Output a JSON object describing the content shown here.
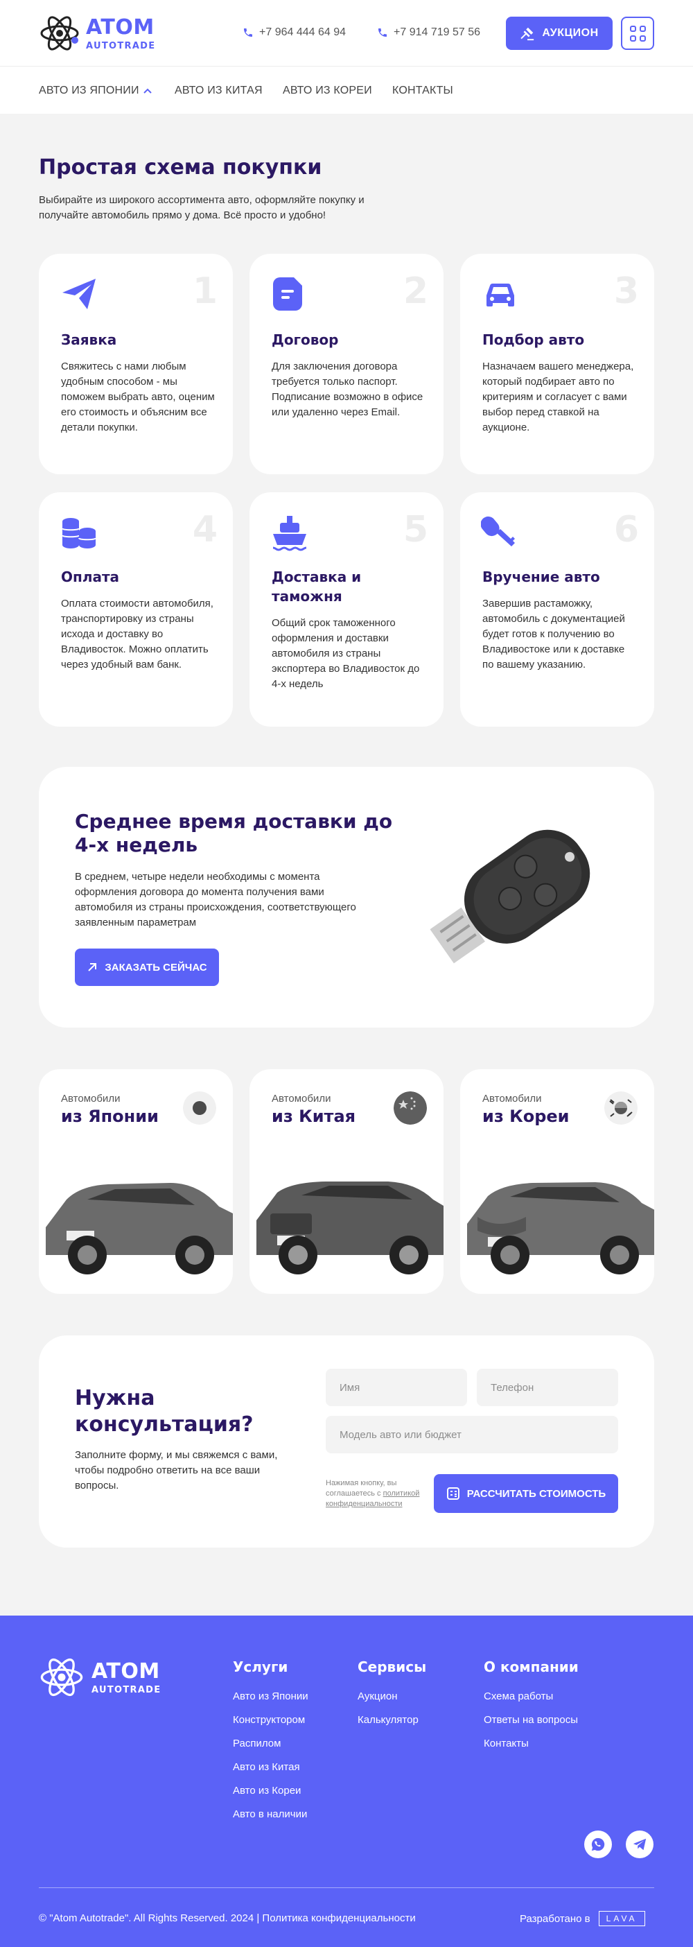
{
  "header": {
    "logo_title": "ATOM",
    "logo_sub": "AUTOTRADE",
    "phone1": "+7 964 444 64 94",
    "phone2": "+7 914 719 57 56",
    "auction_label": "АУКЦИОН"
  },
  "nav": {
    "items": [
      {
        "label": "АВТО ИЗ ЯПОНИИ"
      },
      {
        "label": "АВТО ИЗ КИТАЯ"
      },
      {
        "label": "АВТО ИЗ КОРЕИ"
      },
      {
        "label": "КОНТАКТЫ"
      }
    ]
  },
  "steps": {
    "title": "Простая схема покупки",
    "subtitle": "Выбирайте из широкого ассортимента авто, оформляйте покупку и получайте автомобиль прямо у дома. Всё просто и удобно!",
    "items": [
      {
        "num": "1",
        "icon": "paper-plane-icon",
        "title": "Заявка",
        "text": "Свяжитесь с нами любым удобным способом - мы поможем выбрать авто, оценим его стоимость и объясним все детали покупки."
      },
      {
        "num": "2",
        "icon": "document-icon",
        "title": "Договор",
        "text": "Для заключения договора требуется только паспорт. Подписание возможно в офисе или удаленно через Email."
      },
      {
        "num": "3",
        "icon": "car-icon",
        "title": "Подбор авто",
        "text": "Назначаем вашего менеджера, который подбирает авто по критериям и согласует с вами выбор перед ставкой на аукционе."
      },
      {
        "num": "4",
        "icon": "coins-icon",
        "title": "Оплата",
        "text": "Оплата стоимости автомобиля, транспортировку из страны исхода и доставку во Владивосток. Можно оплатить через удобный вам банк."
      },
      {
        "num": "5",
        "icon": "ship-icon",
        "title": "Доставка и таможня",
        "text": "Общий срок таможенного оформления и доставки автомобиля из страны экспортера во Владивосток до 4-х недель"
      },
      {
        "num": "6",
        "icon": "key-icon",
        "title": "Вручение авто",
        "text": "Завершив растаможку, автомобиль с документацией будет готов к получению во Владивостоке или к доставке по вашему указанию."
      }
    ]
  },
  "delivery": {
    "title": "Среднее время доставки до 4-х недель",
    "text": "В среднем, четыре недели необходимы с момента оформления договора до момента получения вами автомобиля из страны происхождения, соответствующего заявленным параметрам",
    "button": "ЗАКАЗАТЬ СЕЙЧАС"
  },
  "countries": [
    {
      "pre": "Автомобили",
      "title": "из Японии",
      "flag": "japan-flag-icon",
      "color": "#6b6b6b"
    },
    {
      "pre": "Автомобили",
      "title": "из Китая",
      "flag": "china-flag-icon",
      "color": "#5a5a5a"
    },
    {
      "pre": "Автомобили",
      "title": "из Кореи",
      "flag": "korea-flag-icon",
      "color": "#6e6e6e"
    }
  ],
  "consult": {
    "title": "Нужна консультация?",
    "text": "Заполните форму, и мы свяжемся с вами, чтобы подробно ответить на все ваши вопросы.",
    "name_placeholder": "Имя",
    "phone_placeholder": "Телефон",
    "model_placeholder": "Модель авто или бюджет",
    "note_prefix": "Нажимая кнопку, вы соглашаетесь с ",
    "note_link": "политикой конфиденциальности",
    "button": "РАССЧИТАТЬ СТОИМОСТЬ"
  },
  "footer": {
    "logo_title": "ATOM",
    "logo_sub": "AUTOTRADE",
    "col1": {
      "title": "Услуги",
      "links": [
        "Авто из Японии",
        "Конструктором",
        "Распилом",
        "Авто из Китая",
        "Авто из Кореи",
        "Авто в наличии"
      ]
    },
    "col2": {
      "title": "Сервисы",
      "links": [
        "Аукцион",
        "Калькулятор"
      ]
    },
    "col3": {
      "title": "О компании",
      "links": [
        "Схема работы",
        "Ответы на вопросы",
        "Контакты"
      ]
    },
    "copyright": "©  \"Atom Autotrade\". All Rights Reserved. 2024 | Политика конфиденциальности",
    "dev_label": "Разработано в",
    "dev_logo": "LAVA"
  },
  "colors": {
    "accent": "#5b62f7",
    "heading": "#2b1863",
    "bg": "#f3f3f3"
  }
}
